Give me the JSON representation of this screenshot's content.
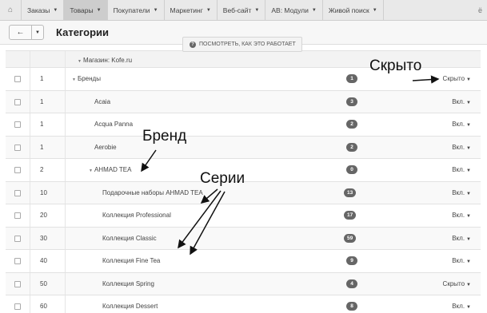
{
  "nav": {
    "items": [
      {
        "label": "Заказы",
        "active": false
      },
      {
        "label": "Товары",
        "active": true
      },
      {
        "label": "Покупатели",
        "active": false
      },
      {
        "label": "Маркетинг",
        "active": false
      },
      {
        "label": "Веб-сайт",
        "active": false
      },
      {
        "label": "AB: Модули",
        "active": false
      },
      {
        "label": "Живой поиск",
        "active": false
      }
    ],
    "right_label": "ё"
  },
  "header": {
    "title": "Категории",
    "how_it_works": "ПОСМОТРЕТЬ, КАК ЭТО РАБОТАЕТ"
  },
  "store": {
    "label": "Магазин: Kofe.ru"
  },
  "rows": [
    {
      "pos": "1",
      "name": "Бренды",
      "level": 1,
      "expanded": true,
      "count": "1",
      "status": "Скрыто"
    },
    {
      "pos": "1",
      "name": "Acaia",
      "level": 2,
      "expanded": false,
      "count": "3",
      "status": "Вкл."
    },
    {
      "pos": "1",
      "name": "Acqua Panna",
      "level": 2,
      "expanded": false,
      "count": "2",
      "status": "Вкл."
    },
    {
      "pos": "1",
      "name": "Aerobie",
      "level": 2,
      "expanded": false,
      "count": "2",
      "status": "Вкл."
    },
    {
      "pos": "2",
      "name": "AHMAD TEA",
      "level": 2,
      "expanded": true,
      "count": "0",
      "status": "Вкл."
    },
    {
      "pos": "10",
      "name": "Подарочные наборы AHMAD TEA",
      "level": 3,
      "expanded": false,
      "count": "13",
      "status": "Вкл."
    },
    {
      "pos": "20",
      "name": "Коллекция Professional",
      "level": 3,
      "expanded": false,
      "count": "17",
      "status": "Вкл."
    },
    {
      "pos": "30",
      "name": "Коллекция Classic",
      "level": 3,
      "expanded": false,
      "count": "59",
      "status": "Вкл."
    },
    {
      "pos": "40",
      "name": "Коллекция Fine Tea",
      "level": 3,
      "expanded": false,
      "count": "9",
      "status": "Вкл."
    },
    {
      "pos": "50",
      "name": "Коллекция Spring",
      "level": 3,
      "expanded": false,
      "count": "4",
      "status": "Скрыто"
    },
    {
      "pos": "60",
      "name": "Коллекция Dessert",
      "level": 3,
      "expanded": false,
      "count": "8",
      "status": "Вкл."
    }
  ],
  "annotations": {
    "hidden": "Скрыто",
    "brand": "Бренд",
    "series": "Серии"
  },
  "colors": {
    "badge": "#666666",
    "nav_bg": "#e9e9e9",
    "nav_active": "#cdcdcd"
  },
  "icons": [
    "home-icon",
    "back-arrow-icon",
    "question-icon",
    "caret-down-icon"
  ]
}
